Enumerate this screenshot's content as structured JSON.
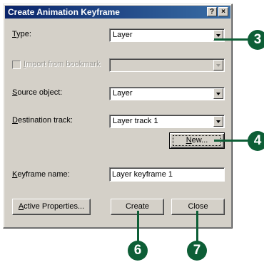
{
  "dialog": {
    "title": "Create Animation Keyframe",
    "help_glyph": "?",
    "close_glyph": "×"
  },
  "fields": {
    "type": {
      "label_u": "T",
      "label_rest": "ype:",
      "value": "Layer"
    },
    "import_bookmark": {
      "label_u": "I",
      "label_rest": "mport from bookmark",
      "value": ""
    },
    "source": {
      "label_u": "S",
      "label_rest": "ource object:",
      "value": "Layer"
    },
    "destination": {
      "label_u": "D",
      "label_rest": "estination track:",
      "value": "Layer track 1"
    },
    "keyframe_name": {
      "label_u": "K",
      "label_rest": "eyframe name:",
      "value": "Layer keyframe 1"
    }
  },
  "buttons": {
    "new": {
      "u": "N",
      "rest": "ew..."
    },
    "active_properties": {
      "u": "A",
      "rest": "ctive Properties..."
    },
    "create": "Create",
    "close": "Close"
  },
  "callouts": {
    "c3": "3",
    "c4": "4",
    "c6": "6",
    "c7": "7"
  },
  "colors": {
    "callout": "#0d5e36",
    "titlebar": "#0a246a",
    "dialog_bg": "#d4d0c8"
  }
}
